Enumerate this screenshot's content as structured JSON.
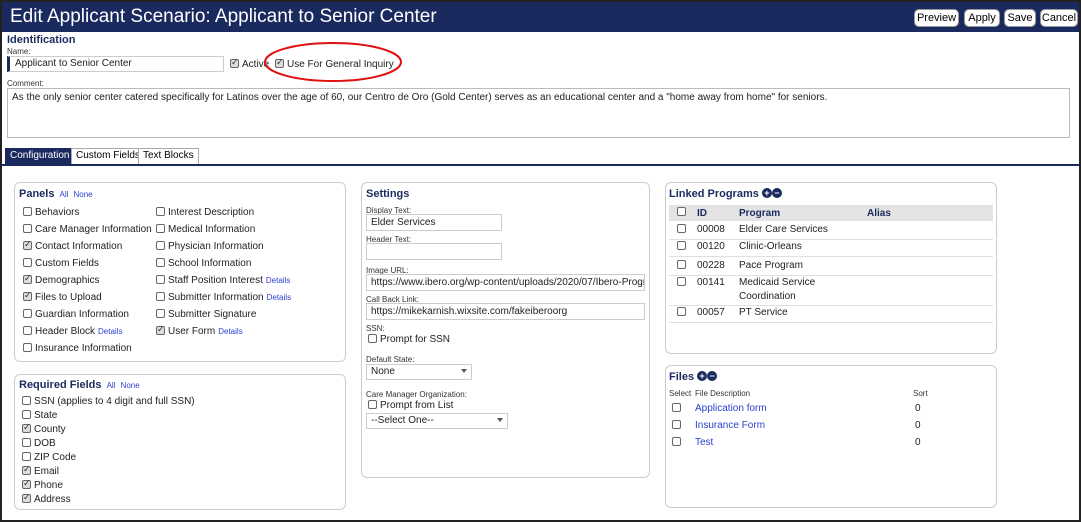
{
  "header": {
    "title": "Edit Applicant Scenario: Applicant to Senior Center",
    "buttons": {
      "preview": "Preview",
      "apply": "Apply",
      "save": "Save",
      "cancel": "Cancel"
    }
  },
  "identification": {
    "section_title": "Identification",
    "name_label": "Name:",
    "name_value": "Applicant to Senior Center",
    "active_label": "Active",
    "general_inquiry_label": "Use For General Inquiry",
    "comment_label": "Comment:",
    "comment_value": "As the only senior center catered specifically for Latinos over the age of 60, our Centro de Oro (Gold Center) serves as an educational center and a \"home away from home\" for seniors."
  },
  "tabs": [
    "Configuration",
    "Custom Fields",
    "Text Blocks"
  ],
  "panels": {
    "title": "Panels",
    "all": "All",
    "none": "None",
    "col1": [
      {
        "label": "Behaviors",
        "checked": false
      },
      {
        "label": "Care Manager Information",
        "checked": false
      },
      {
        "label": "Contact Information",
        "checked": true
      },
      {
        "label": "Custom Fields",
        "checked": false
      },
      {
        "label": "Demographics",
        "checked": true
      },
      {
        "label": "Files to Upload",
        "checked": true
      },
      {
        "label": "Guardian Information",
        "checked": false
      },
      {
        "label": "Header Block",
        "checked": false,
        "details": "Details"
      },
      {
        "label": "Insurance Information",
        "checked": false
      }
    ],
    "col2": [
      {
        "label": "Interest Description",
        "checked": false
      },
      {
        "label": "Medical Information",
        "checked": false
      },
      {
        "label": "Physician Information",
        "checked": false
      },
      {
        "label": "School Information",
        "checked": false
      },
      {
        "label": "Staff Position Interest",
        "checked": false,
        "details": "Details"
      },
      {
        "label": "Submitter Information",
        "checked": false,
        "details": "Details"
      },
      {
        "label": "Submitter Signature",
        "checked": false
      },
      {
        "label": "User Form",
        "checked": true,
        "details": "Details"
      }
    ]
  },
  "required_fields": {
    "title": "Required Fields",
    "all": "All",
    "none": "None",
    "items": [
      {
        "label": "SSN (applies to 4 digit and full SSN)",
        "checked": false
      },
      {
        "label": "State",
        "checked": false
      },
      {
        "label": "County",
        "checked": true
      },
      {
        "label": "DOB",
        "checked": false
      },
      {
        "label": "ZIP Code",
        "checked": false
      },
      {
        "label": "Email",
        "checked": true
      },
      {
        "label": "Phone",
        "checked": true
      },
      {
        "label": "Address",
        "checked": true
      }
    ]
  },
  "settings": {
    "title": "Settings",
    "display_text_label": "Display Text:",
    "display_text": "Elder Services",
    "header_text_label": "Header Text:",
    "header_text": "",
    "image_url_label": "Image URL:",
    "image_url": "https://www.ibero.org/wp-content/uploads/2020/07/Ibero-Progr",
    "callback_label": "Call Back Link:",
    "callback": "https://mikekarnish.wixsite.com/fakeiberoorg",
    "ssn_label": "SSN:",
    "ssn_prompt": "Prompt for SSN",
    "default_state_label": "Default State:",
    "default_state": "None",
    "cm_org_label": "Care Manager Organization:",
    "cm_prompt": "Prompt from List",
    "cm_select": "--Select One--"
  },
  "linked_programs": {
    "title": "Linked Programs",
    "headers": {
      "id": "ID",
      "program": "Program",
      "alias": "Alias"
    },
    "rows": [
      {
        "id": "00008",
        "program": "Elder Care Services",
        "program2": ""
      },
      {
        "id": "00120",
        "program": "Clinic-Orleans",
        "program2": ""
      },
      {
        "id": "00228",
        "program": "Pace Program",
        "program2": ""
      },
      {
        "id": "00141",
        "program": "Medicaid Service",
        "program2": "Coordination"
      },
      {
        "id": "00057",
        "program": "PT Service",
        "program2": ""
      }
    ]
  },
  "files": {
    "title": "Files",
    "headers": {
      "select": "Select",
      "desc": "File Description",
      "sort": "Sort"
    },
    "rows": [
      {
        "desc": "Application form",
        "sort": "0"
      },
      {
        "desc": "Insurance Form",
        "sort": "0"
      },
      {
        "desc": "Test",
        "sort": "0"
      }
    ]
  },
  "colors": {
    "header": "#1b2a5e",
    "link": "#2a3fd0",
    "annotation": "#e01010"
  }
}
